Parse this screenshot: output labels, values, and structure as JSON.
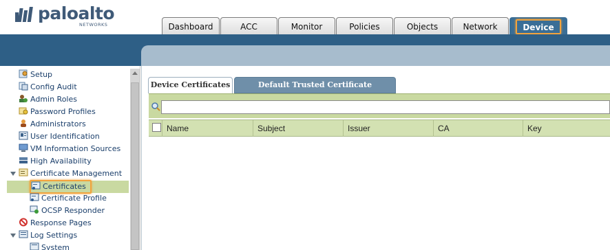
{
  "brand": {
    "name": "paloalto",
    "sub": "NETWORKS",
    "colors": {
      "primary": "#3f5a78",
      "nav_blue": "#2e5f86",
      "highlight": "#f2a33c",
      "selection_green": "#c9d9a1"
    }
  },
  "tabs": [
    "Dashboard",
    "ACC",
    "Monitor",
    "Policies",
    "Objects",
    "Network",
    "Device"
  ],
  "active_tab": "Device",
  "sidebar": {
    "items": [
      {
        "label": "Setup",
        "icon": "setup-icon"
      },
      {
        "label": "Config Audit",
        "icon": "config-audit-icon"
      },
      {
        "label": "Admin Roles",
        "icon": "admin-roles-icon"
      },
      {
        "label": "Password Profiles",
        "icon": "password-profiles-icon"
      },
      {
        "label": "Administrators",
        "icon": "administrators-icon"
      },
      {
        "label": "User Identification",
        "icon": "user-identification-icon"
      },
      {
        "label": "VM Information Sources",
        "icon": "vm-sources-icon"
      },
      {
        "label": "High Availability",
        "icon": "high-availability-icon"
      },
      {
        "label": "Certificate Management",
        "icon": "certificate-management-icon",
        "expanded": true
      },
      {
        "label": "Certificates",
        "icon": "certificates-icon",
        "selected": true
      },
      {
        "label": "Certificate Profile",
        "icon": "certificate-profile-icon"
      },
      {
        "label": "OCSP Responder",
        "icon": "ocsp-responder-icon"
      },
      {
        "label": "Response Pages",
        "icon": "response-pages-icon"
      },
      {
        "label": "Log Settings",
        "icon": "log-settings-icon",
        "expanded": true
      },
      {
        "label": "System",
        "icon": "system-log-icon"
      }
    ]
  },
  "subtabs": [
    "Device Certificates",
    "Default Trusted Certificate Authorities"
  ],
  "active_subtab": "Device Certificates",
  "search": {
    "value": "",
    "placeholder": ""
  },
  "table": {
    "columns": [
      "Name",
      "Subject",
      "Issuer",
      "CA",
      "Key"
    ],
    "rows": []
  }
}
